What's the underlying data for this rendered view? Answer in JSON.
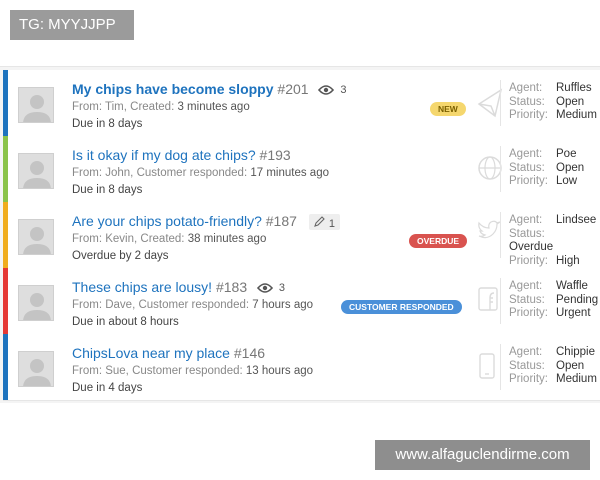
{
  "badge": "TG: MYYJJPP",
  "watermark": "www.alfaguclendirme.com",
  "labels": {
    "agent": "Agent:",
    "status": "Status:",
    "priority": "Priority:"
  },
  "colors": {
    "blue": "#1e73be",
    "green": "#8bc34a",
    "orange": "#f0ad1f",
    "red": "#e53935",
    "new": "#f5d76e",
    "overdue": "#d9534f",
    "responded": "#4a90d9"
  },
  "tickets": [
    {
      "title": "My chips have become sloppy",
      "number": "#201",
      "count_icon": "eye-icon",
      "count": "3",
      "from": "From: Tim,",
      "event": "Created:",
      "time": "3 minutes ago",
      "due": "Due in 8 days",
      "pill": "NEW",
      "side_icon": "paper-plane-icon",
      "bar_color": "#1e73be",
      "agent": "Ruffles",
      "status": "Open",
      "priority": "Medium"
    },
    {
      "title": "Is it okay if my dog ate chips?",
      "number": "#193",
      "count_icon": "",
      "count": "",
      "from": "From: John,",
      "event": "Customer responded:",
      "time": "17 minutes ago",
      "due": "Due in 8 days",
      "pill": "",
      "side_icon": "globe-icon",
      "bar_color": "#8bc34a",
      "agent": "Poe",
      "status": "Open",
      "priority": "Low"
    },
    {
      "title": "Are your chips potato-friendly?",
      "number": "#187",
      "count_icon": "pencil-icon",
      "count": "1",
      "from": "From: Kevin,",
      "event": "Created:",
      "time": "38 minutes ago",
      "due": "Overdue by 2 days",
      "pill": "OVERDUE",
      "side_icon": "twitter-icon",
      "bar_color": "#f0ad1f",
      "agent": "Lindsee",
      "status": "Overdue",
      "priority": "High"
    },
    {
      "title": "These chips are lousy!",
      "number": "#183",
      "count_icon": "eye-icon",
      "count": "3",
      "from": "From: Dave,",
      "event": "Customer responded:",
      "time": "7 hours ago",
      "due": "Due in about 8 hours",
      "pill": "CUSTOMER RESPONDED",
      "side_icon": "facebook-icon",
      "bar_color": "#e53935",
      "agent": "Waffle",
      "status": "Pending",
      "priority": "Urgent"
    },
    {
      "title": "ChipsLova near my place",
      "number": "#146",
      "count_icon": "",
      "count": "",
      "from": "From: Sue,",
      "event": "Customer responded:",
      "time": "13 hours ago",
      "due": "Due in 4 days",
      "pill": "",
      "side_icon": "phone-icon",
      "bar_color": "#1e73be",
      "agent": "Chippie",
      "status": "Open",
      "priority": "Medium"
    }
  ]
}
